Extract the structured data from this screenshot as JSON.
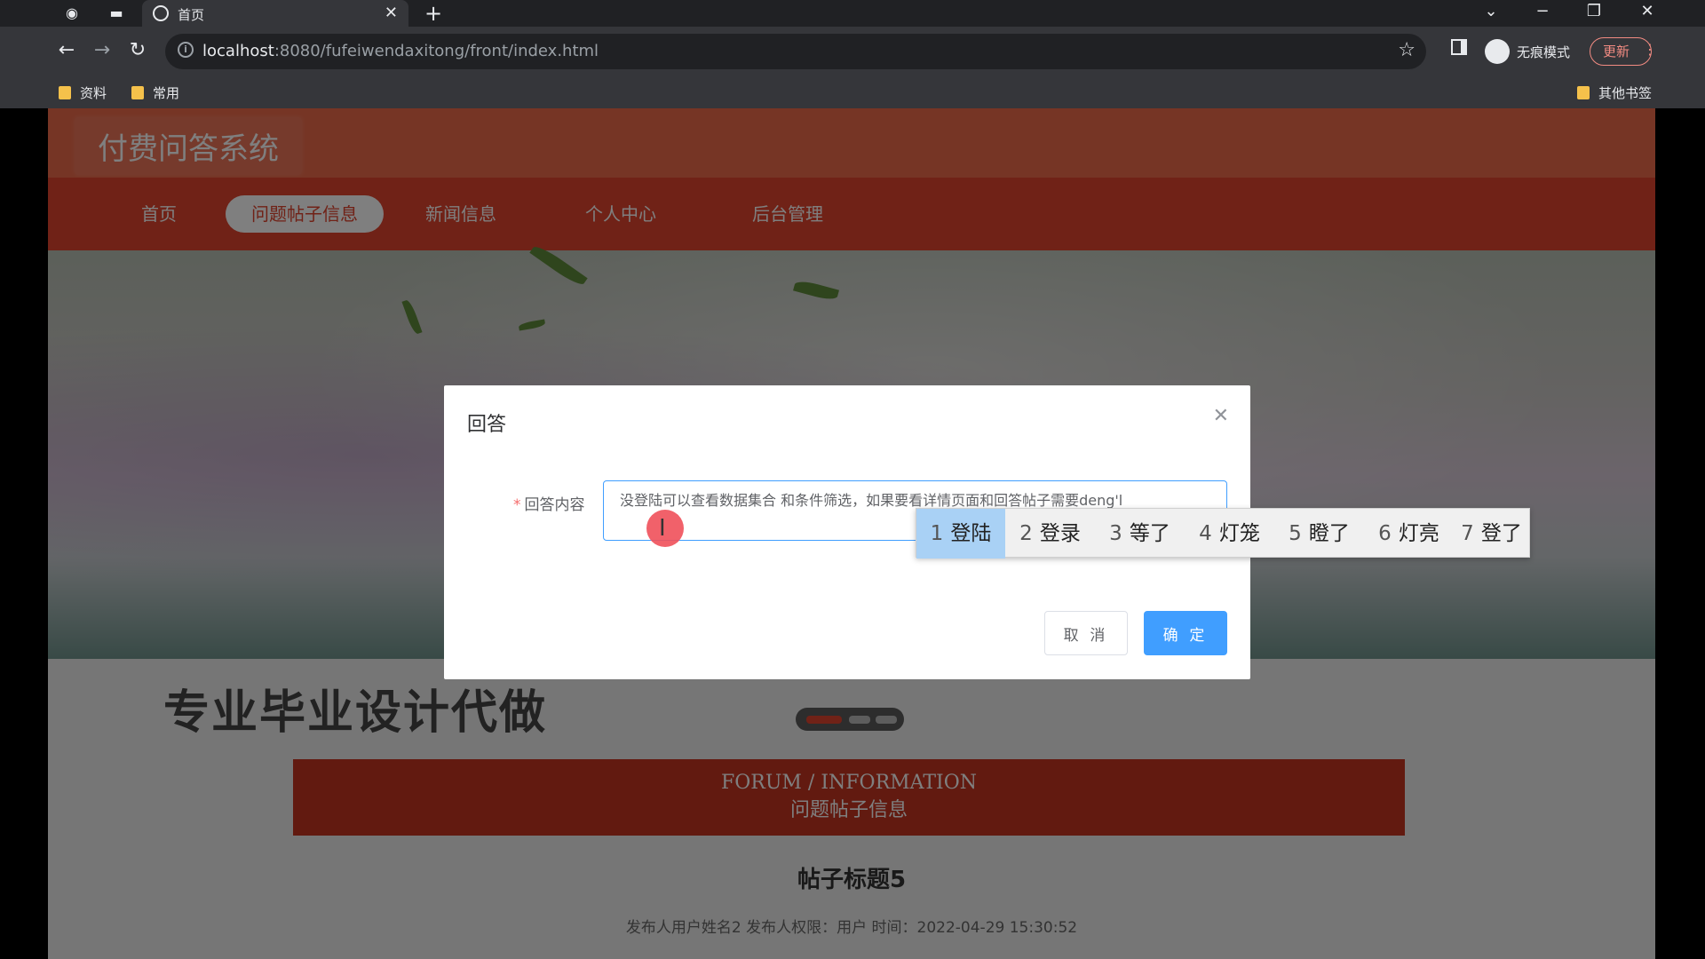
{
  "browser": {
    "tab_title": "首页",
    "url_host": "localhost",
    "url_rest": ":8080/fufeiwendaxitong/front/index.html",
    "incognito_label": "无痕模式",
    "update_label": "更新",
    "bookmarks": [
      "资料",
      "常用"
    ],
    "other_bookmarks": "其他书签"
  },
  "site": {
    "title": "付费问答系统",
    "nav": [
      "首页",
      "问题帖子信息",
      "新闻信息",
      "个人中心",
      "后台管理"
    ],
    "active_nav": "问题帖子信息"
  },
  "section": {
    "en": "FORUM / INFORMATION",
    "cn": "问题帖子信息"
  },
  "watermark": "专业毕业设计代做",
  "post": {
    "title": "帖子标题5",
    "meta": "发布人用户姓名2   发布人权限：用户   时间：2022-04-29 15:30:52"
  },
  "dialog": {
    "title": "回答",
    "field_label": "回答内容",
    "field_value": "没登陆可以查看数据集合 和条件筛选，如果要看详情页面和回答帖子需要deng'l",
    "cancel_label": "取 消",
    "confirm_label": "确 定"
  },
  "ime": {
    "candidates": [
      {
        "num": "1",
        "text": "登陆"
      },
      {
        "num": "2",
        "text": "登录"
      },
      {
        "num": "3",
        "text": "等了"
      },
      {
        "num": "4",
        "text": "灯笼"
      },
      {
        "num": "5",
        "text": "瞪了"
      },
      {
        "num": "6",
        "text": "灯亮"
      },
      {
        "num": "7",
        "text": "登了"
      }
    ]
  },
  "colors": {
    "header": "#ec6a4a",
    "nav": "#e0452f",
    "primary_button": "#409eff",
    "section_band": "#c43520"
  }
}
